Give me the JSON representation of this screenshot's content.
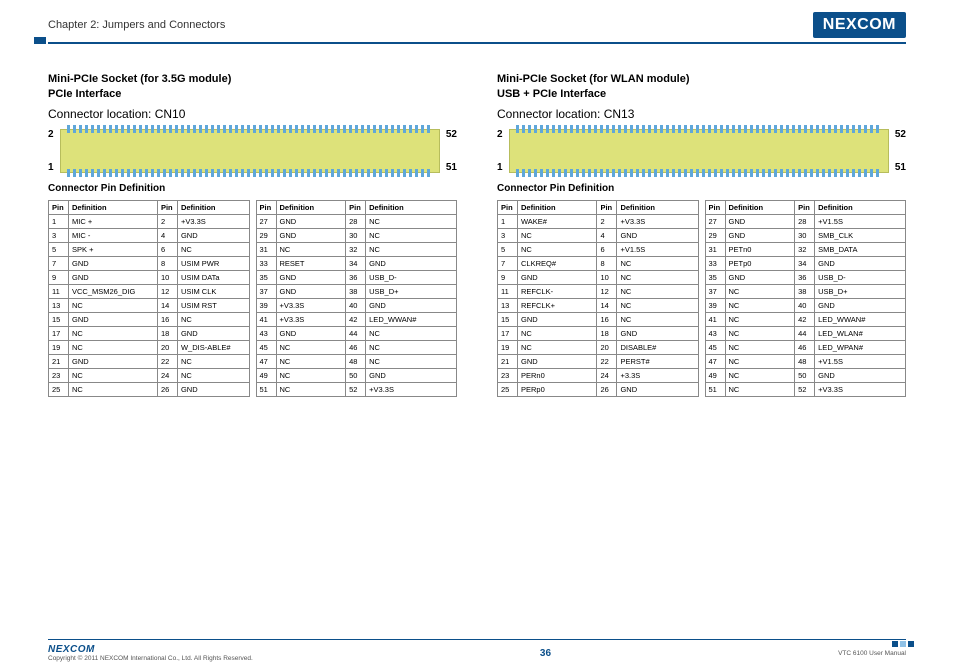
{
  "header": {
    "chapter": "Chapter 2: Jumpers and Connectors",
    "logo": "NEXCOM"
  },
  "left": {
    "title1": "Mini-PCIe Socket (for 3.5G module)",
    "title2": "PCIe Interface",
    "connloc": "Connector location: CN10",
    "pin_tl": "2",
    "pin_tr": "52",
    "pin_bl": "1",
    "pin_br": "51",
    "table_title": "Connector Pin Definition",
    "tableA": [
      [
        "1",
        "MIC +",
        "2",
        "+V3.3S"
      ],
      [
        "3",
        "MIC -",
        "4",
        "GND"
      ],
      [
        "5",
        "SPK +",
        "6",
        "NC"
      ],
      [
        "7",
        "GND",
        "8",
        "USIM PWR"
      ],
      [
        "9",
        "GND",
        "10",
        "USIM DATa"
      ],
      [
        "11",
        "VCC_MSM26_DIG",
        "12",
        "USIM CLK"
      ],
      [
        "13",
        "NC",
        "14",
        "USIM RST"
      ],
      [
        "15",
        "GND",
        "16",
        "NC"
      ],
      [
        "17",
        "NC",
        "18",
        "GND"
      ],
      [
        "19",
        "NC",
        "20",
        "W_DIS-ABLE#"
      ],
      [
        "21",
        "GND",
        "22",
        "NC"
      ],
      [
        "23",
        "NC",
        "24",
        "NC"
      ],
      [
        "25",
        "NC",
        "26",
        "GND"
      ]
    ],
    "tableB": [
      [
        "27",
        "GND",
        "28",
        "NC"
      ],
      [
        "29",
        "GND",
        "30",
        "NC"
      ],
      [
        "31",
        "NC",
        "32",
        "NC"
      ],
      [
        "33",
        "RESET",
        "34",
        "GND"
      ],
      [
        "35",
        "GND",
        "36",
        "USB_D-"
      ],
      [
        "37",
        "GND",
        "38",
        "USB_D+"
      ],
      [
        "39",
        "+V3.3S",
        "40",
        "GND"
      ],
      [
        "41",
        "+V3.3S",
        "42",
        "LED_WWAN#"
      ],
      [
        "43",
        "GND",
        "44",
        "NC"
      ],
      [
        "45",
        "NC",
        "46",
        "NC"
      ],
      [
        "47",
        "NC",
        "48",
        "NC"
      ],
      [
        "49",
        "NC",
        "50",
        "GND"
      ],
      [
        "51",
        "NC",
        "52",
        "+V3.3S"
      ]
    ]
  },
  "right": {
    "title1": "Mini-PCIe Socket (for WLAN module)",
    "title2": "USB + PCIe Interface",
    "connloc": "Connector location: CN13",
    "pin_tl": "2",
    "pin_tr": "52",
    "pin_bl": "1",
    "pin_br": "51",
    "table_title": "Connector Pin Definition",
    "tableA": [
      [
        "1",
        "WAKE#",
        "2",
        "+V3.3S"
      ],
      [
        "3",
        "NC",
        "4",
        "GND"
      ],
      [
        "5",
        "NC",
        "6",
        "+V1.5S"
      ],
      [
        "7",
        "CLKREQ#",
        "8",
        "NC"
      ],
      [
        "9",
        "GND",
        "10",
        "NC"
      ],
      [
        "11",
        "REFCLK-",
        "12",
        "NC"
      ],
      [
        "13",
        "REFCLK+",
        "14",
        "NC"
      ],
      [
        "15",
        "GND",
        "16",
        "NC"
      ],
      [
        "17",
        "NC",
        "18",
        "GND"
      ],
      [
        "19",
        "NC",
        "20",
        "DISABLE#"
      ],
      [
        "21",
        "GND",
        "22",
        "PERST#"
      ],
      [
        "23",
        "PERn0",
        "24",
        "+3.3S"
      ],
      [
        "25",
        "PERp0",
        "26",
        "GND"
      ]
    ],
    "tableB": [
      [
        "27",
        "GND",
        "28",
        "+V1.5S"
      ],
      [
        "29",
        "GND",
        "30",
        "SMB_CLK"
      ],
      [
        "31",
        "PETn0",
        "32",
        "SMB_DATA"
      ],
      [
        "33",
        "PETp0",
        "34",
        "GND"
      ],
      [
        "35",
        "GND",
        "36",
        "USB_D-"
      ],
      [
        "37",
        "NC",
        "38",
        "USB_D+"
      ],
      [
        "39",
        "NC",
        "40",
        "GND"
      ],
      [
        "41",
        "NC",
        "42",
        "LED_WWAN#"
      ],
      [
        "43",
        "NC",
        "44",
        "LED_WLAN#"
      ],
      [
        "45",
        "NC",
        "46",
        "LED_WPAN#"
      ],
      [
        "47",
        "NC",
        "48",
        "+V1.5S"
      ],
      [
        "49",
        "NC",
        "50",
        "GND"
      ],
      [
        "51",
        "NC",
        "52",
        "+V3.3S"
      ]
    ]
  },
  "footer": {
    "logo": "NEXCOM",
    "copyright": "Copyright © 2011 NEXCOM International Co., Ltd. All Rights Reserved.",
    "page": "36",
    "manual": "VTC 6100 User Manual"
  },
  "table_headers": [
    "Pin",
    "Definition",
    "Pin",
    "Definition"
  ]
}
